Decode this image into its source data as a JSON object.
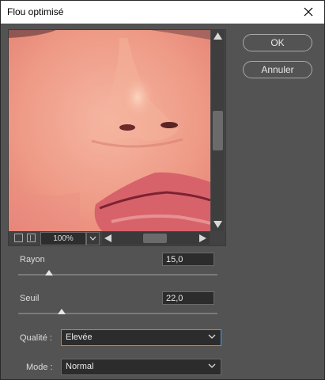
{
  "window": {
    "title": "Flou optimisé"
  },
  "buttons": {
    "ok": "OK",
    "cancel": "Annuler"
  },
  "preview": {
    "zoom": "100%"
  },
  "params": {
    "rayon_label": "Rayon",
    "rayon_value": "15,0",
    "seuil_label": "Seuil",
    "seuil_value": "22,0",
    "qualite_label": "Qualité :",
    "qualite_value": "Elevée",
    "mode_label": "Mode :",
    "mode_value": "Normal"
  },
  "sliders": {
    "rayon_fraction": 0.155,
    "seuil_fraction": 0.22
  },
  "icons": [
    "close-icon",
    "scroll-up-icon",
    "scroll-down-icon",
    "scroll-left-icon",
    "scroll-right-icon",
    "zoom-out-icon",
    "zoom-in-icon",
    "chevron-down-icon"
  ],
  "colors": {
    "dialog_bg": "#535353",
    "field_bg": "#2c2c2c",
    "focus_border": "#4aa0e8"
  }
}
